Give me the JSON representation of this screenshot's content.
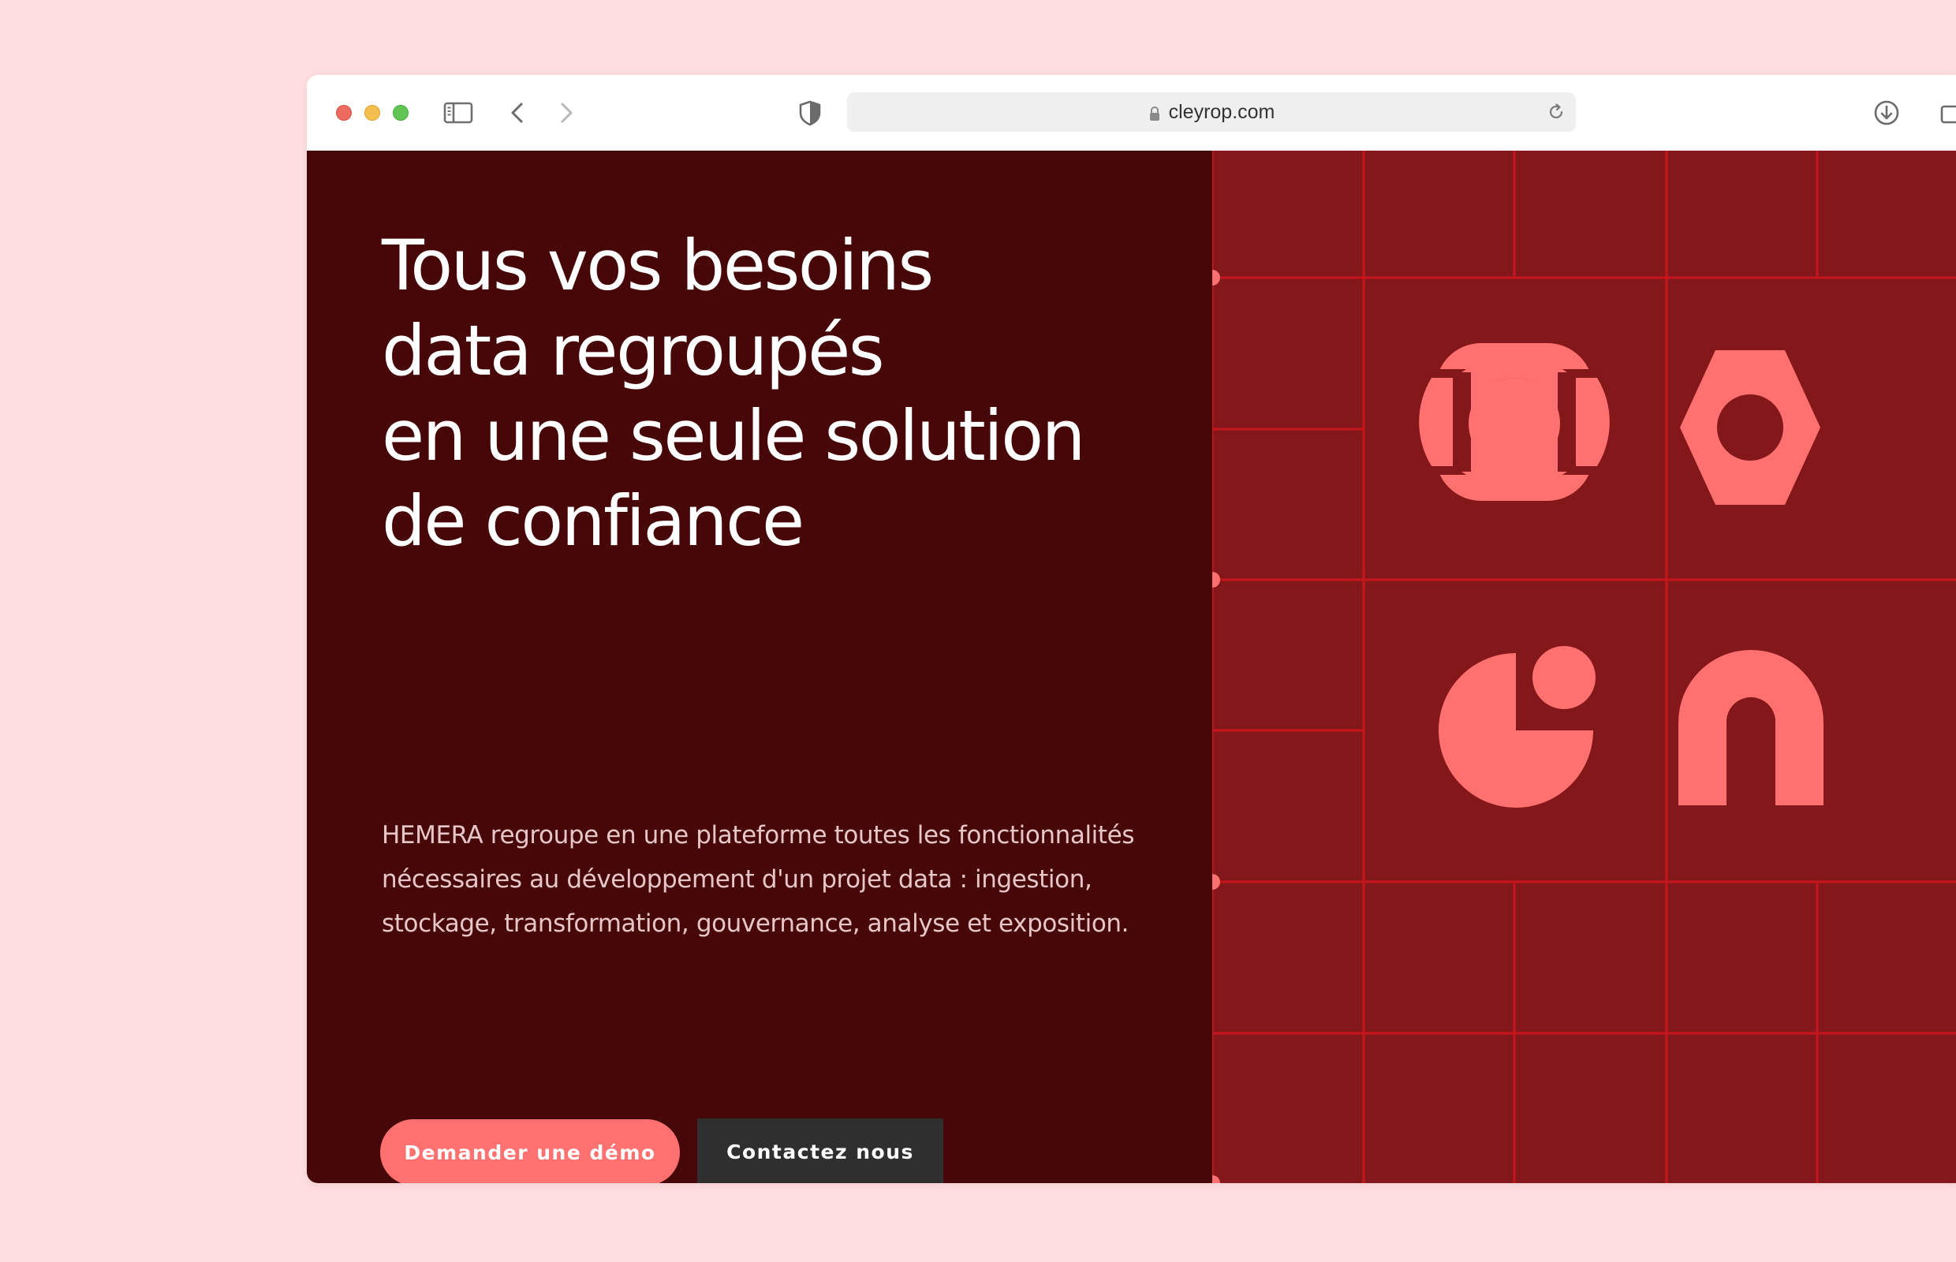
{
  "browser": {
    "url": "cleyrop.com",
    "toolbar_icons": [
      "sidebar-icon",
      "back-icon",
      "forward-icon",
      "shield-icon",
      "lock-icon",
      "reload-icon",
      "download-icon",
      "tabs-icon"
    ]
  },
  "hero": {
    "headline_lines": [
      "Tous vos besoins",
      "data regroupés",
      "en une seule solution",
      "de confiance"
    ],
    "description": "HEMERA regroupe en une plateforme toutes les fonctionnalités nécessaires au développement d'un projet data : ingestion, stockage, transformation, gouvernance, analyse et exposition.",
    "primary_button": "Demander une démo",
    "secondary_button": "Contactez nous"
  },
  "graphic": {
    "shapes": [
      "rounded-square-ring-icon",
      "hexagon-ring-icon",
      "pie-with-dot-icon",
      "arch-icon"
    ]
  },
  "colors": {
    "page_background": "#ffdfe1",
    "hero_dark": "#470709",
    "graphic_background": "#83171a",
    "grid_line": "#c8141c",
    "accent_coral": "#ff7070",
    "contact_button": "#2f2f2f"
  }
}
